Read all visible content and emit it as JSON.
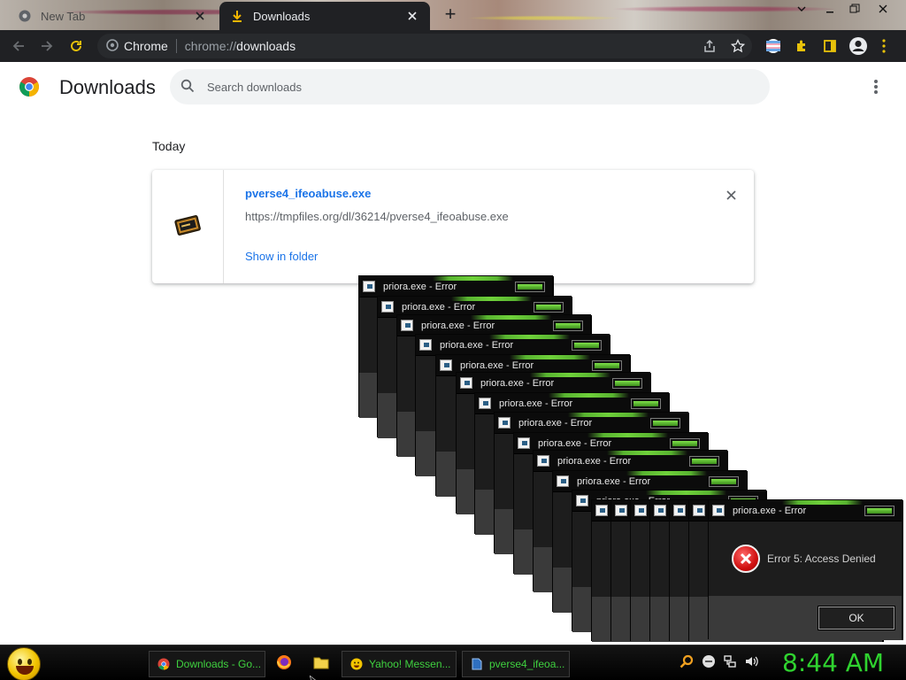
{
  "browser": {
    "tabs": [
      {
        "title": "New Tab",
        "icon": "chrome-icon",
        "active": false
      },
      {
        "title": "Downloads",
        "icon": "download-icon",
        "active": true
      }
    ],
    "new_tab_glyph": "+",
    "omnibox": {
      "site_label": "Chrome",
      "url_scheme": "chrome://",
      "url_host": "downloads"
    }
  },
  "downloads": {
    "page_title": "Downloads",
    "search_placeholder": "Search downloads",
    "date_header": "Today",
    "items": [
      {
        "file_name": "pverse4_ifeoabuse.exe",
        "url": "https://tmpfiles.org/dl/36214/pverse4_ifeoabuse.exe",
        "action_label": "Show in folder"
      }
    ]
  },
  "error_dialogs": {
    "title": "priora.exe - Error",
    "message": "Error 5: Access Denied",
    "ok_label": "OK",
    "count": 17
  },
  "taskbar": {
    "tasks": [
      {
        "label": "Downloads - Go...",
        "icon": "chrome-icon"
      },
      {
        "label": "Yahoo! Messen...",
        "icon": "smiley-icon"
      },
      {
        "label": "pverse4_ifeoa...",
        "icon": "document-icon"
      }
    ],
    "quick_launch": [
      "firefox-icon",
      "folder-icon"
    ],
    "tray": [
      "search-icon",
      "smiley-icon",
      "network-icon",
      "speaker-icon"
    ],
    "clock": "8:44 AM"
  },
  "colors": {
    "chrome_dark": "#202124",
    "link_blue": "#1a73e8",
    "taskbar_green": "#3fd13f",
    "error_red": "#d01010"
  }
}
